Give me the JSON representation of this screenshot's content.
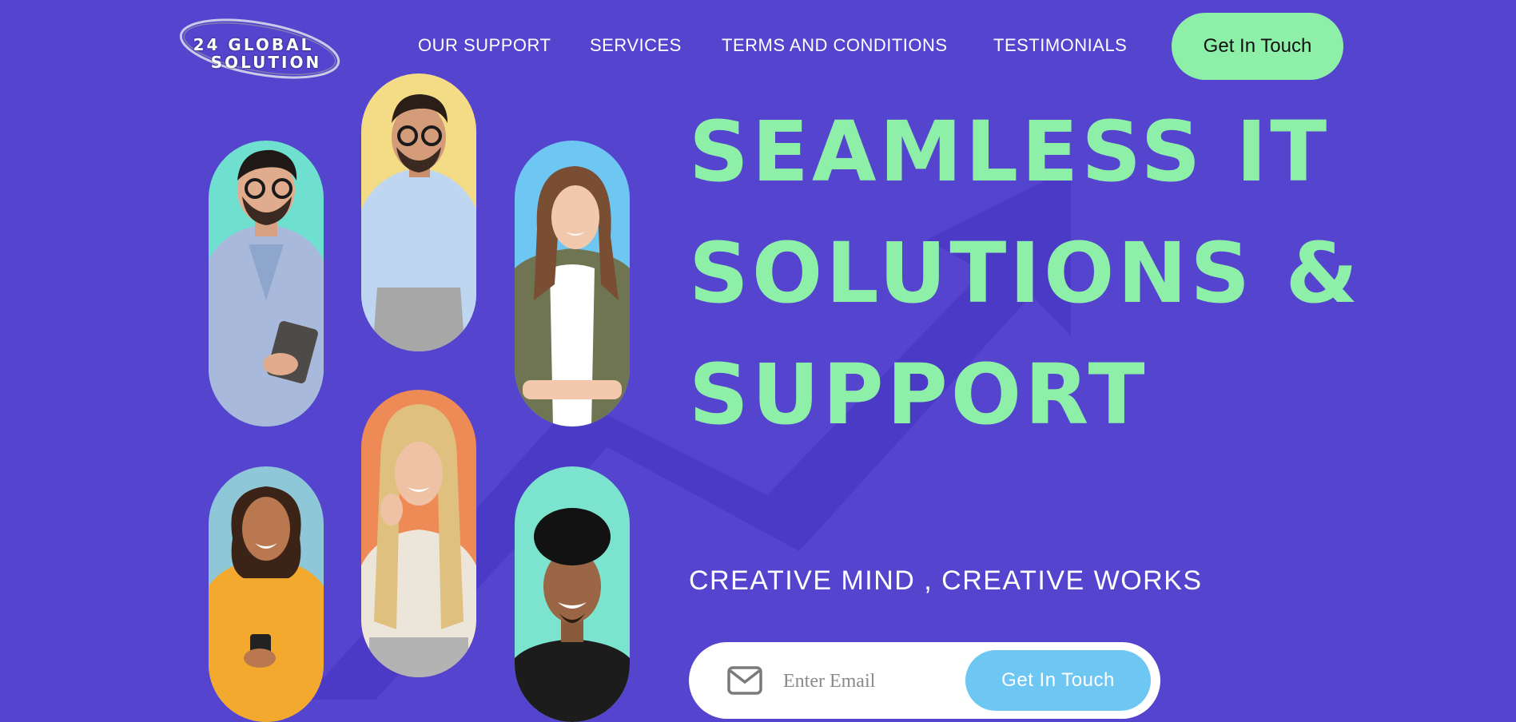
{
  "page": {
    "background_color": "#5544CE",
    "accent_color": "#8EF0A8",
    "secondary_button_color": "#6EC6F2"
  },
  "header": {
    "logo": {
      "line1": "24 GLOBAL",
      "line2": "SOLUTION"
    },
    "nav": [
      {
        "label": "OUR SUPPORT"
      },
      {
        "label": "SERVICES"
      },
      {
        "label": "TERMS AND CONDITIONS"
      },
      {
        "label": "TESTIMONIALS"
      }
    ],
    "cta_label": "Get In Touch"
  },
  "gallery": {
    "photos": [
      {
        "subject": "man with glasses holding tablet",
        "bg": "#6FE0CF"
      },
      {
        "subject": "woman in yellow sweater with phone",
        "bg": "#8EC7D8"
      },
      {
        "subject": "smiling man with glasses at laptop",
        "bg": "#F4DC86"
      },
      {
        "subject": "blonde woman on phone",
        "bg": "#EE8A55"
      },
      {
        "subject": "woman in olive jacket",
        "bg": "#6EC6F2"
      },
      {
        "subject": "smiling man with curly hair",
        "bg": "#7CE3CE"
      }
    ]
  },
  "hero": {
    "title_lines": [
      "SEAMLESS IT",
      "SOLUTIONS &",
      "SUPPORT"
    ],
    "tagline": "CREATIVE MIND , CREATIVE WORKS",
    "email_placeholder": "Enter Email",
    "cta_label": "Get In Touch"
  }
}
